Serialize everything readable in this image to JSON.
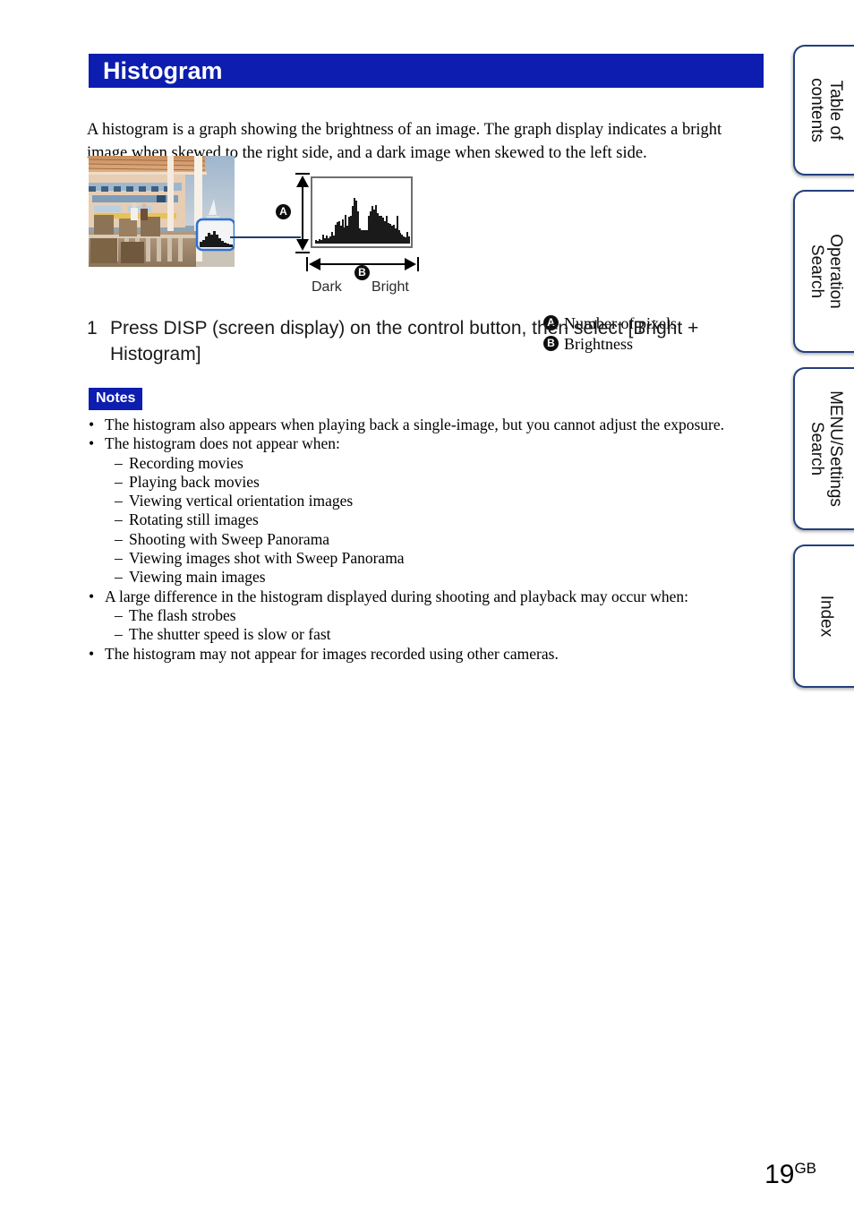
{
  "page": {
    "title": "Histogram",
    "number": "19",
    "number_suffix": "GB"
  },
  "colors": {
    "header_blue": "#0c1daf",
    "tab_border": "#22407c",
    "callout_blue": "#1d3f6e",
    "histogram_bar": "#1a1a1a"
  },
  "intro": {
    "paragraph": "A histogram is a graph showing the brightness of an image. The graph display indicates a bright image when skewed to the right side, and a dark image when skewed to the left side."
  },
  "figure": {
    "badge_a": "A",
    "badge_b": "B",
    "axis_dark": "Dark",
    "axis_bright": "Bright",
    "legend": [
      {
        "badge": "A",
        "text": "Number of pixels"
      },
      {
        "badge": "B",
        "text": "Brightness"
      }
    ]
  },
  "chart_data": {
    "type": "bar",
    "title": "Histogram",
    "xlabel": "Brightness",
    "ylabel": "Number of pixels",
    "x_tick_labels": [
      "Dark",
      "Bright"
    ],
    "grid": false,
    "legend_position": "right",
    "ylim": [
      0,
      100
    ],
    "categories": [
      "0",
      "1",
      "2",
      "3",
      "4",
      "5",
      "6",
      "7",
      "8",
      "9",
      "10",
      "11",
      "12",
      "13",
      "14",
      "15",
      "16",
      "17",
      "18",
      "19",
      "20",
      "21",
      "22",
      "23",
      "24",
      "25",
      "26",
      "27",
      "28",
      "29",
      "30",
      "31",
      "32",
      "33",
      "34",
      "35",
      "36",
      "37",
      "38",
      "39",
      "40",
      "41",
      "42",
      "43",
      "44",
      "45",
      "46",
      "47",
      "48",
      "49",
      "50",
      "51",
      "52",
      "53"
    ],
    "values": [
      6,
      5,
      7,
      6,
      14,
      8,
      13,
      9,
      12,
      18,
      13,
      30,
      34,
      36,
      29,
      38,
      26,
      46,
      29,
      43,
      44,
      60,
      73,
      68,
      52,
      24,
      22,
      21,
      22,
      22,
      44,
      52,
      60,
      54,
      62,
      48,
      45,
      44,
      42,
      36,
      44,
      33,
      31,
      28,
      30,
      25,
      45,
      22,
      17,
      14,
      12,
      10,
      18,
      12
    ]
  },
  "step": {
    "number": "1",
    "text": "Press DISP (screen display) on the control button, then select [Bright + Histogram]"
  },
  "notes": {
    "badge_label": "Notes",
    "bullet": "•",
    "dash": "–",
    "items": [
      {
        "level": 1,
        "text": "The histogram also appears when playing back a single-image, but you cannot adjust the exposure."
      },
      {
        "level": 1,
        "text": "The histogram does not appear when:"
      },
      {
        "level": 2,
        "text": "Recording movies"
      },
      {
        "level": 2,
        "text": "Playing back movies"
      },
      {
        "level": 2,
        "text": "Viewing vertical orientation images"
      },
      {
        "level": 2,
        "text": "Rotating still images"
      },
      {
        "level": 2,
        "text": "Shooting with Sweep Panorama"
      },
      {
        "level": 2,
        "text": "Viewing images shot with Sweep Panorama"
      },
      {
        "level": 2,
        "text": "Viewing main images"
      },
      {
        "level": 1,
        "text": "A large difference in the histogram displayed during shooting and playback may occur when:"
      },
      {
        "level": 2,
        "text": "The flash strobes"
      },
      {
        "level": 2,
        "text": "The shutter speed is slow or fast"
      },
      {
        "level": 1,
        "text": "The histogram may not appear for images recorded using other cameras."
      }
    ]
  },
  "tabs": [
    {
      "label": "Table of\ncontents"
    },
    {
      "label": "Operation\nSearch"
    },
    {
      "label": "MENU/Settings\nSearch"
    },
    {
      "label": "Index"
    }
  ]
}
